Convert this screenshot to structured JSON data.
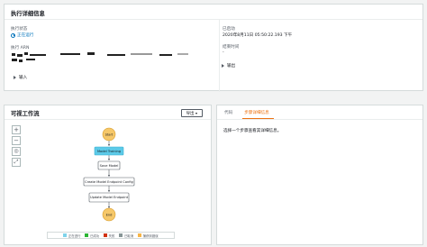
{
  "details": {
    "title": "执行详细信息",
    "status_label": "执行状态",
    "status_value": "正在运行",
    "arn_label": "执行 ARN",
    "started_label": "已启动",
    "started_value": "2020年8月11日 05:50:22.193 下午",
    "ended_label": "结束时间",
    "ended_value": "-",
    "input_label": "输入",
    "output_label": "输出"
  },
  "graph": {
    "title": "可视工作流",
    "export_label": "导出",
    "zoom_in": "+",
    "zoom_out": "−",
    "center": "◎",
    "fit": "⤢",
    "nodes": {
      "start": "Start",
      "training": "Model Training",
      "save": "Save Model",
      "create_config": "Create Model Endpoint Config",
      "update_endpoint": "Update Model Endpoint",
      "end": "End"
    },
    "legend": [
      {
        "label": "正在进行",
        "color": "#7fd3ea"
      },
      {
        "label": "已成功",
        "color": "#2bb534"
      },
      {
        "label": "失败",
        "color": "#d13212"
      },
      {
        "label": "已取消",
        "color": "#879596"
      },
      {
        "label": "捕获到错误",
        "color": "#f7b548"
      }
    ]
  },
  "step_panel": {
    "tabs": [
      "代码",
      "步骤详细信息"
    ],
    "message": "选择一个步骤查看其详细信息。"
  },
  "colors": {
    "node_running": "#5ccae8",
    "node_terminal": "#f6c86a",
    "accent": "#ec7211",
    "link": "#0073bb"
  }
}
